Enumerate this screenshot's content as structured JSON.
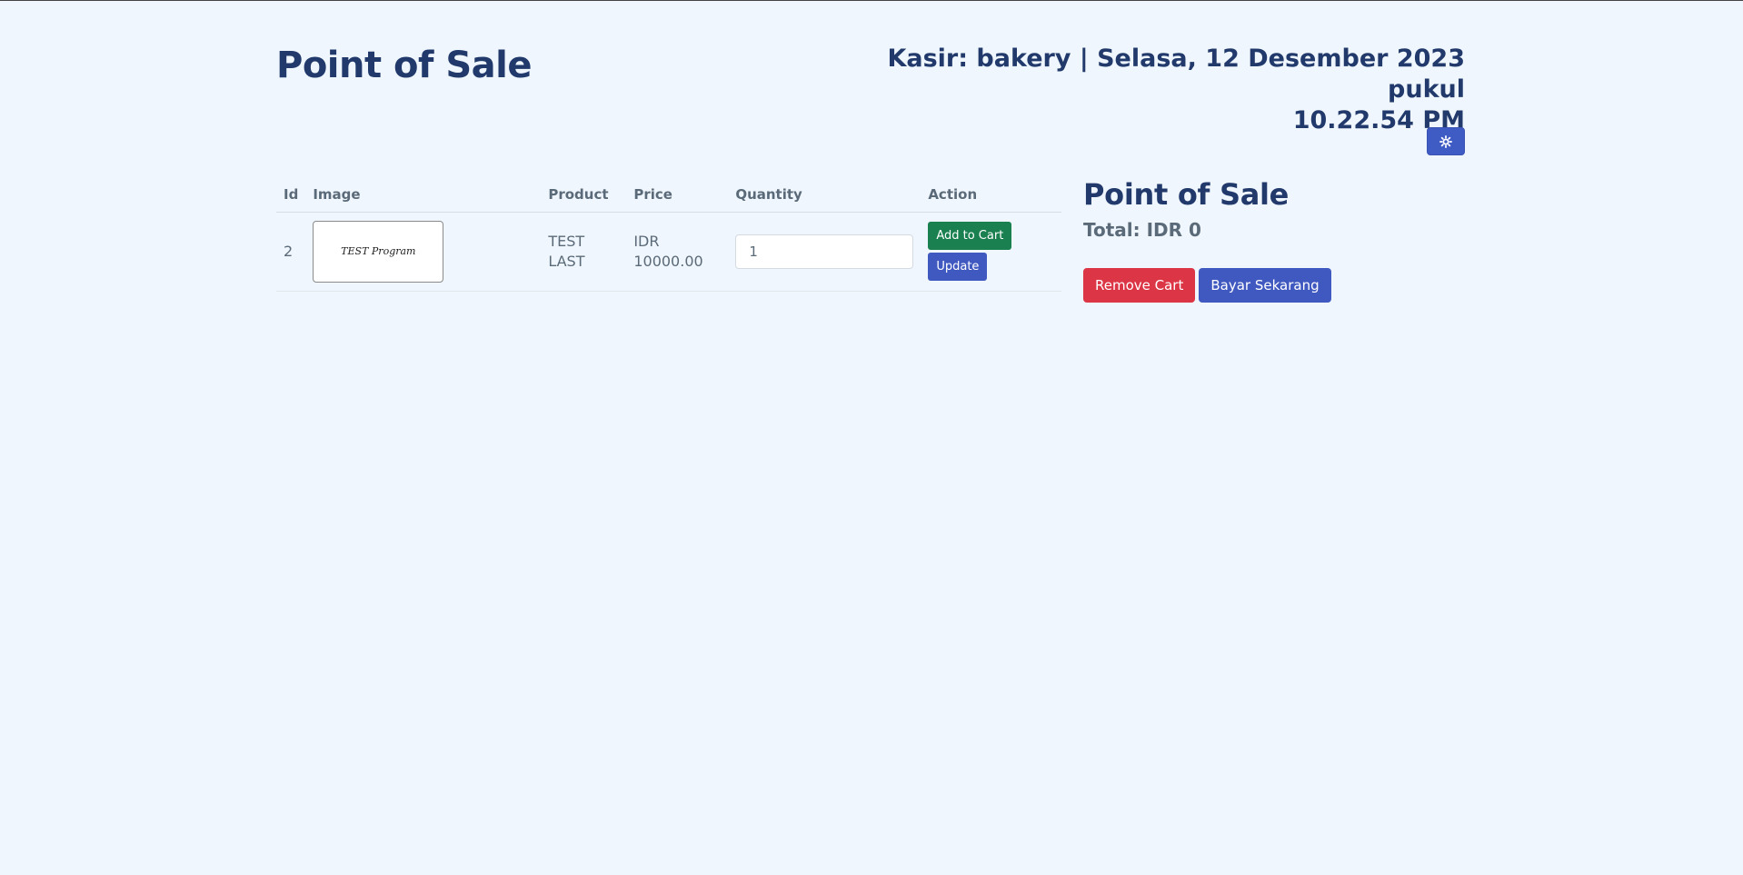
{
  "header": {
    "title": "Point of Sale",
    "info_line1": "Kasir: bakery | Selasa, 12 Desember 2023 pukul",
    "info_line2": "10.22.54 PM"
  },
  "theme_toggle": {
    "icon": "gear-icon",
    "color": "#3f5bc4"
  },
  "table": {
    "columns": [
      "Id",
      "Image",
      "Product",
      "Price",
      "Quantity",
      "Action"
    ],
    "rows": [
      {
        "id": "2",
        "image_text": "TEST Program",
        "product": "TEST LAST",
        "price": "IDR 10000.00",
        "quantity": "1",
        "add_label": "Add to Cart",
        "update_label": "Update"
      }
    ]
  },
  "cart": {
    "title": "Point of Sale",
    "total": "Total: IDR 0",
    "remove_label": "Remove Cart",
    "pay_label": "Bayar Sekarang"
  },
  "colors": {
    "heading": "#213a6b",
    "primary": "#4059c0",
    "success": "#1a8050",
    "danger": "#dc3545",
    "background": "#f0f6fd"
  }
}
